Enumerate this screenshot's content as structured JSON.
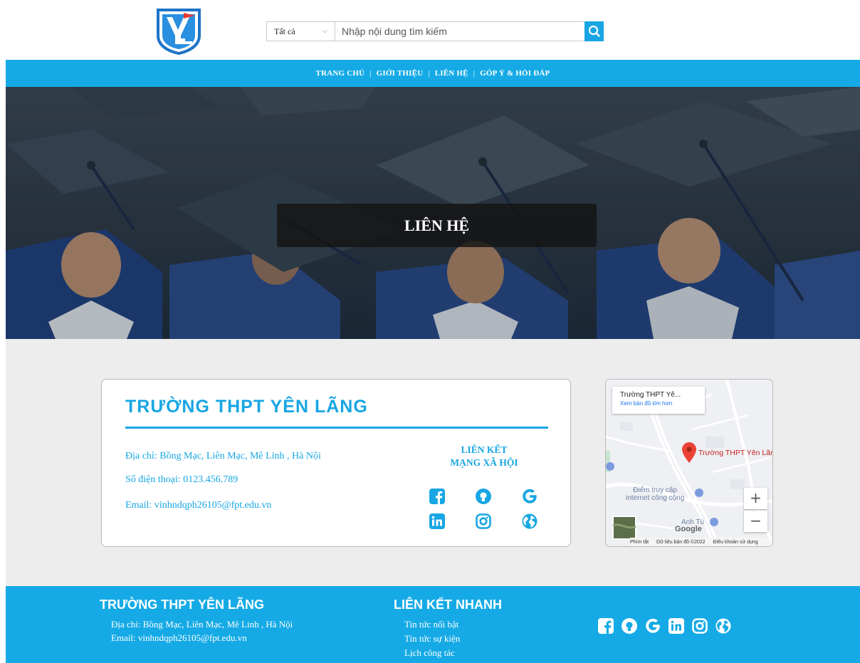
{
  "header": {
    "logo_icon": "school-logo-icon",
    "search": {
      "category": "Tất cả",
      "placeholder": "Nhập nội dung tìm kiếm",
      "button_icon": "search-icon"
    }
  },
  "nav": {
    "items": [
      "TRANG CHỦ",
      "GIỚI THIỆU",
      "LIÊN HỆ",
      "GÓP Ý & HỎI ĐÁP"
    ],
    "separator": "|"
  },
  "hero": {
    "title": "LIÊN HỆ"
  },
  "contact": {
    "school_name": "TRƯỜNG THPT YÊN LÃNG",
    "address": "Địa chỉ: Bồng Mạc, Liên Mạc, Mê Linh , Hà Nội",
    "phone": "Số điện thoại: 0123.456.789",
    "email": "Email: vinhndqph26105@fpt.edu.vn",
    "social_title_line1": "LIÊN KẾT",
    "social_title_line2": "MẠNG XÃ HỘI",
    "social_icons": [
      "facebook-icon",
      "github-icon",
      "google-icon",
      "linkedin-icon",
      "instagram-icon",
      "globe-icon"
    ]
  },
  "map": {
    "place_title": "Trường THPT Yê...",
    "view_larger": "Xem bản đồ lớn hơn",
    "pin_label": "Trường THPT Yên Lãn",
    "poi_1": "Điểm truy cập internet công cộng",
    "poi_1_line1": "Điểm truy cập",
    "poi_1_line2": "internet công cộng",
    "poi_2": "Anh Tú",
    "brand": "Google",
    "footer_shortcuts": "Phím tắt",
    "footer_data": "Dữ liệu bản đồ ©2022",
    "footer_terms": "Điều khoản sử dụng",
    "zoom_in": "+",
    "zoom_out": "−"
  },
  "footer": {
    "col1_title": "TRƯỜNG THPT YÊN LÃNG",
    "col1_address": "Địa chỉ: Bồng Mạc, Liên Mạc, Mê Linh , Hà Nội",
    "col1_email": "Email: vinhndqph26105@fpt.edu.vn",
    "col2_title": "LIÊN KẾT NHANH",
    "links": [
      "Tin tức nổi bật",
      "Tin tức sự kiện",
      "Lịch công tác"
    ]
  },
  "colors": {
    "brand_blue": "#15aae6",
    "background_gray": "#ededed",
    "map_pin_red": "#ea4335"
  }
}
